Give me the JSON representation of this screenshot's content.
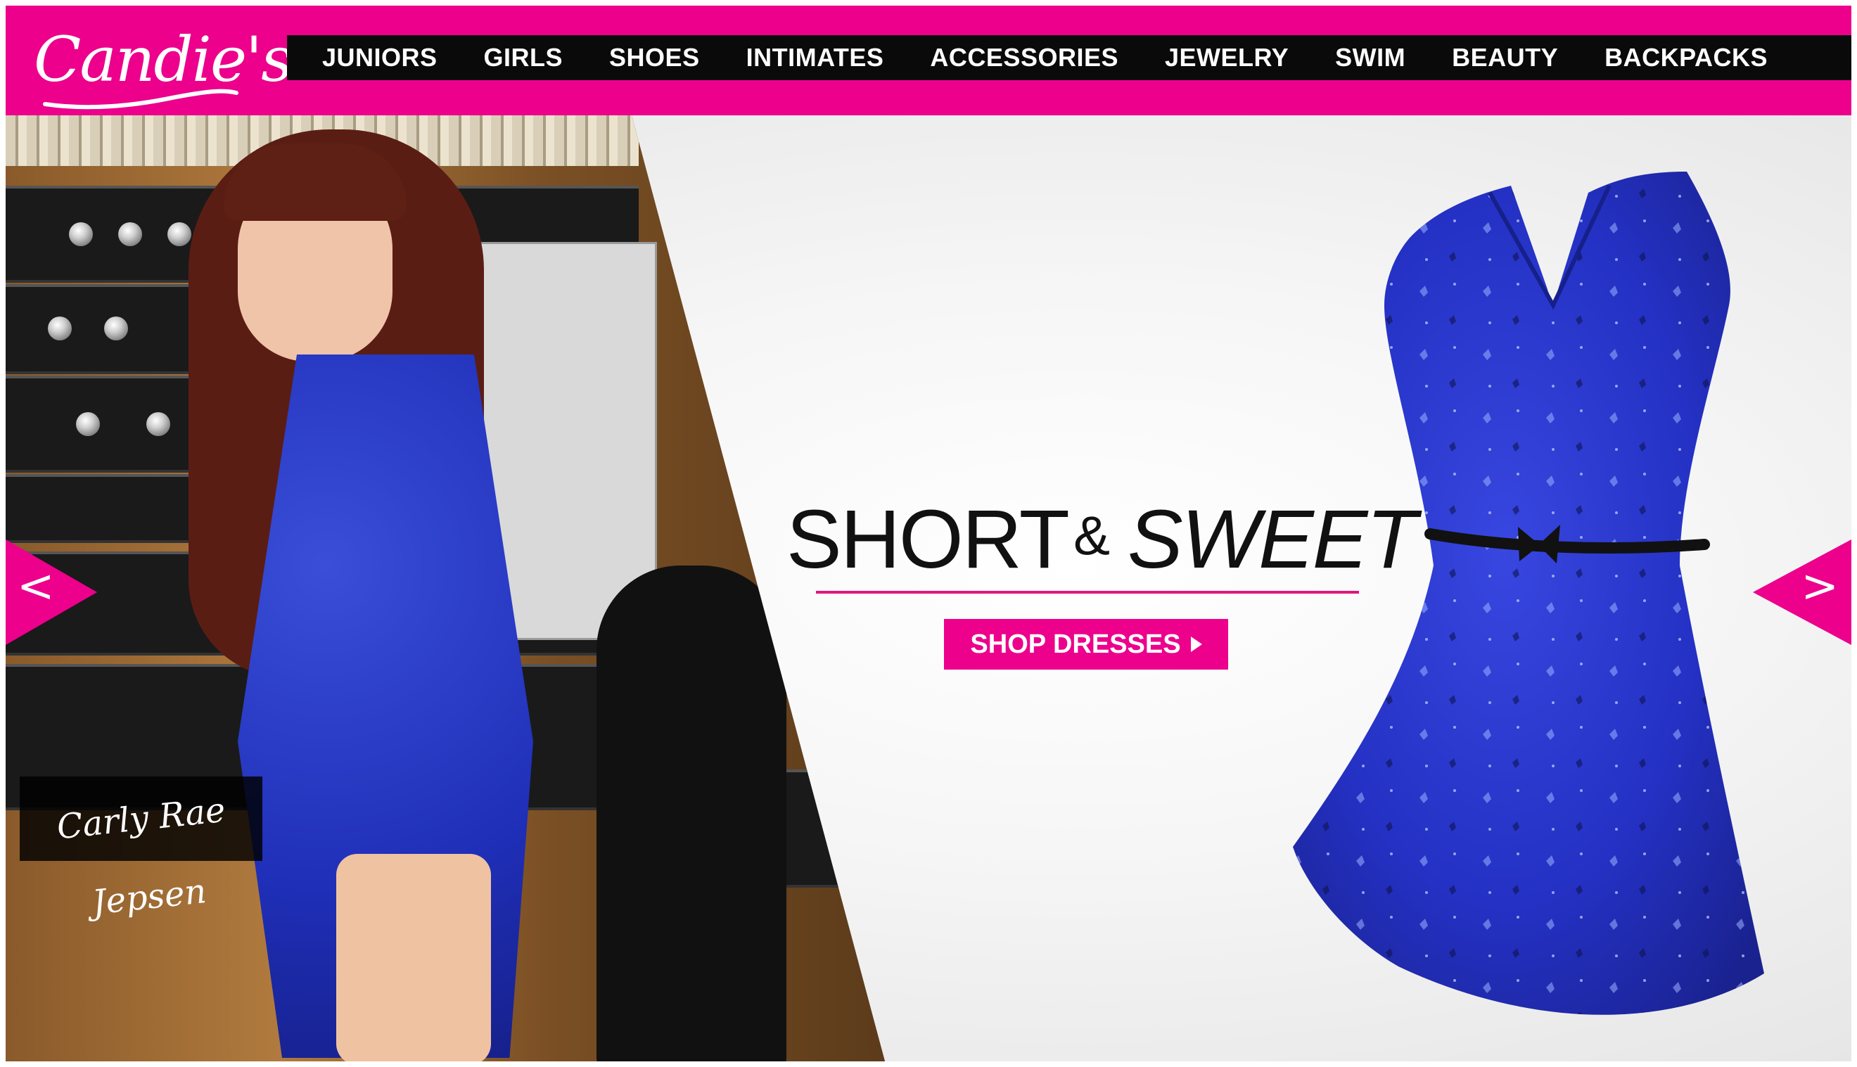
{
  "brand": {
    "logo_text": "Candie's",
    "primary_color": "#ec008c",
    "nav_bg": "#0a0a0a"
  },
  "nav": {
    "items": [
      {
        "label": "JUNIORS"
      },
      {
        "label": "GIRLS"
      },
      {
        "label": "SHOES"
      },
      {
        "label": "INTIMATES"
      },
      {
        "label": "ACCESSORIES"
      },
      {
        "label": "JEWELRY"
      },
      {
        "label": "SWIM"
      },
      {
        "label": "BEAUTY"
      },
      {
        "label": "BACKPACKS"
      }
    ]
  },
  "hero": {
    "headline_part1": "SHORT",
    "headline_amp": "&",
    "headline_part2": "SWEET",
    "cta_label": "SHOP DRESSES",
    "caption": "Carly Rae Jepsen",
    "prev_arrow": "<",
    "next_arrow": ">",
    "dress_color": "#2431c4"
  }
}
